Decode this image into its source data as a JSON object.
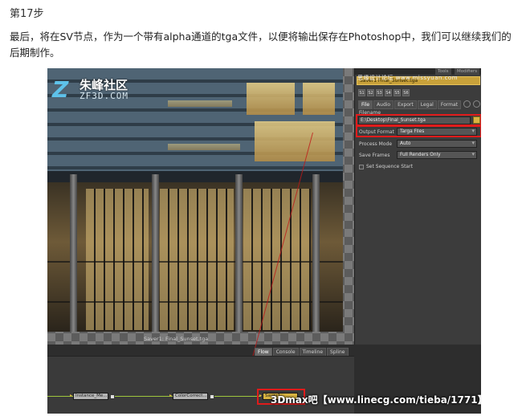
{
  "article": {
    "step_title": "第17步",
    "description": "最后，将在SV节点，作为一个带有alpha通道的tga文件，以便将输出保存在Photoshop中，我们可以继续我们的后期制作。"
  },
  "viewer": {
    "logo_cn": "朱峰社区",
    "logo_en": "ZF3D.COM",
    "caption": "Saver1: Final_Sunset.tga"
  },
  "panel": {
    "top_tabs": [
      "Tools",
      "Modifiers"
    ],
    "watermark": "思缘设计论坛 www.missyuan.com",
    "title": "Saver1 Final_Sunset.tga",
    "chips": [
      "S1",
      "S2",
      "S3",
      "S4",
      "S5",
      "S6"
    ],
    "tabs": [
      "File",
      "Audio",
      "Export",
      "Legal",
      "Format"
    ],
    "filename_label": "Filename",
    "filename_value": "E:\\Desktop\\Final_Sunset.tga",
    "output_format_label": "Output Format",
    "output_format_value": "Targa Files",
    "process_mode_label": "Process Mode",
    "process_mode_value": "Auto",
    "save_frames_label": "Save Frames",
    "save_frames_value": "Full Renders Only",
    "set_sequence_start": "Set Sequence Start"
  },
  "flow": {
    "tabs": [
      "Flow",
      "Console",
      "Timeline",
      "Spline"
    ],
    "nodes": [
      "Instance_Me...",
      "ColorCorrect..."
    ],
    "saver_node": "Saver1"
  },
  "bottom_watermark": "3Dmax吧【www.linecg.com/tieba/1771】",
  "colors": {
    "highlight": "#e01b1b",
    "saver": "#d9b441",
    "wire": "#9ec63c"
  }
}
